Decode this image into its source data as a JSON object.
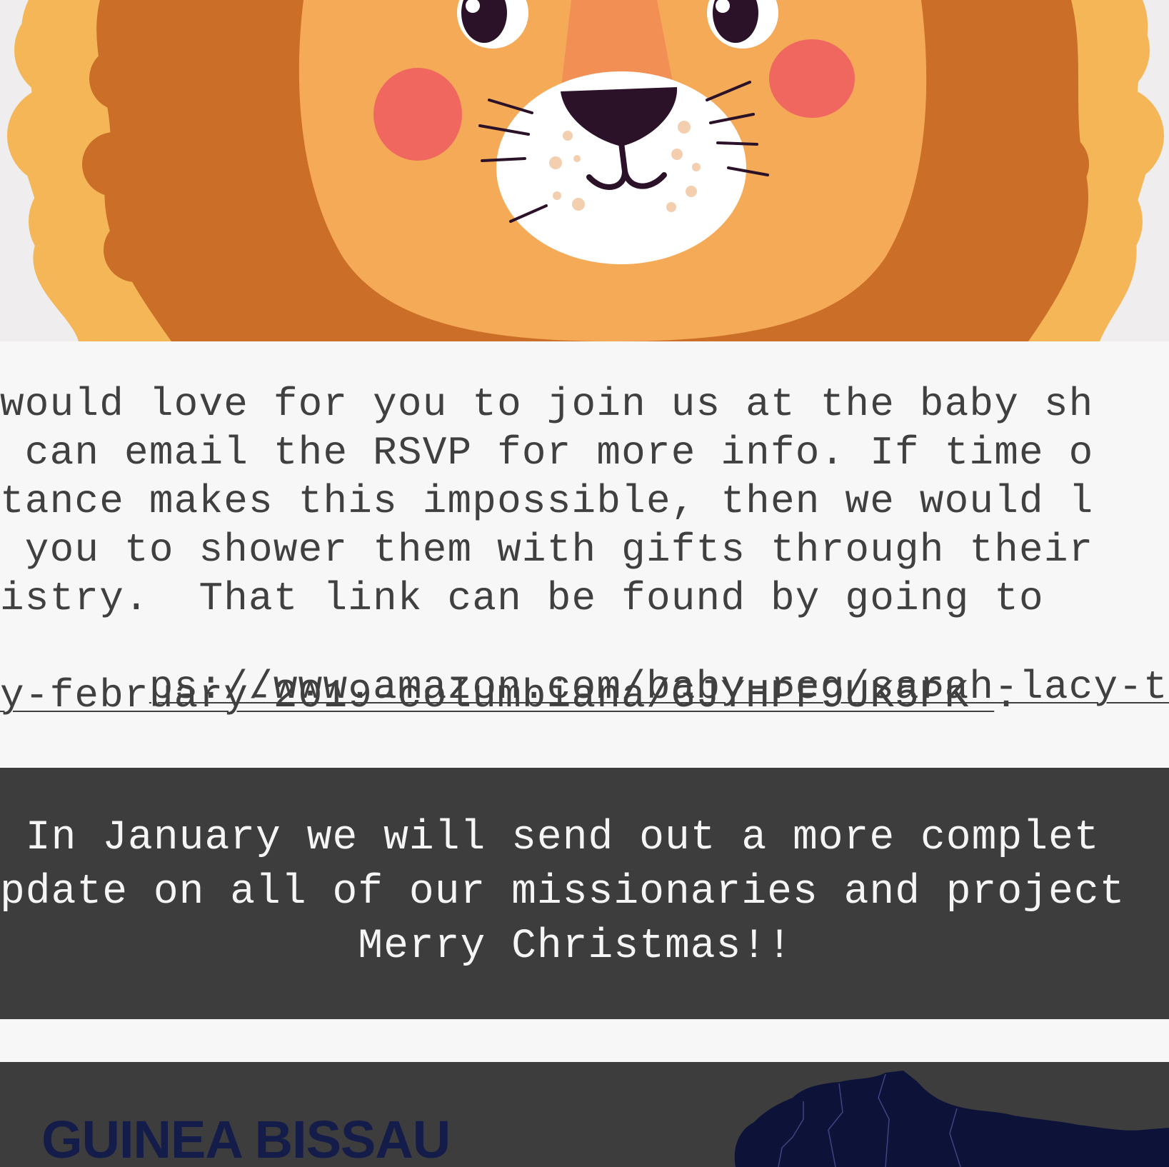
{
  "hero": {
    "illustration": "lion-face-icon",
    "colors": {
      "background": "#efedee",
      "mane_light": "#f5b657",
      "mane_dark": "#cb6e27",
      "face": "#f5aa58",
      "nose_bridge": "#f28f55",
      "nose": "#2b1228",
      "cheeks": "#f06760",
      "muzzle": "#ffffff"
    }
  },
  "message": {
    "lines": [
      "would love for you to join us at the baby sh",
      " can email the RSVP for more info. If time o",
      "tance makes this impossible, then we would l",
      " you to shower them with gifts through their",
      "istry.  That link can be found by going to"
    ],
    "registry_link_line1": "ps://www.amazon.com/baby-reg/sarah-lacy-trav",
    "registry_link_line2": "y-february-2019-columbiana/GJYHPF9UK5PK ",
    "link_suffix": "."
  },
  "announcement": {
    "lines": [
      " In January we will send out a more complet",
      "pdate on all of our missionaries and project",
      "              Merry Christmas!!"
    ]
  },
  "country_section": {
    "title": "GUINEA BISSAU",
    "map_icon": "africa-map-icon",
    "colors": {
      "background": "#3d3d3d",
      "title": "#141c4a",
      "map": "#0d1238"
    }
  }
}
